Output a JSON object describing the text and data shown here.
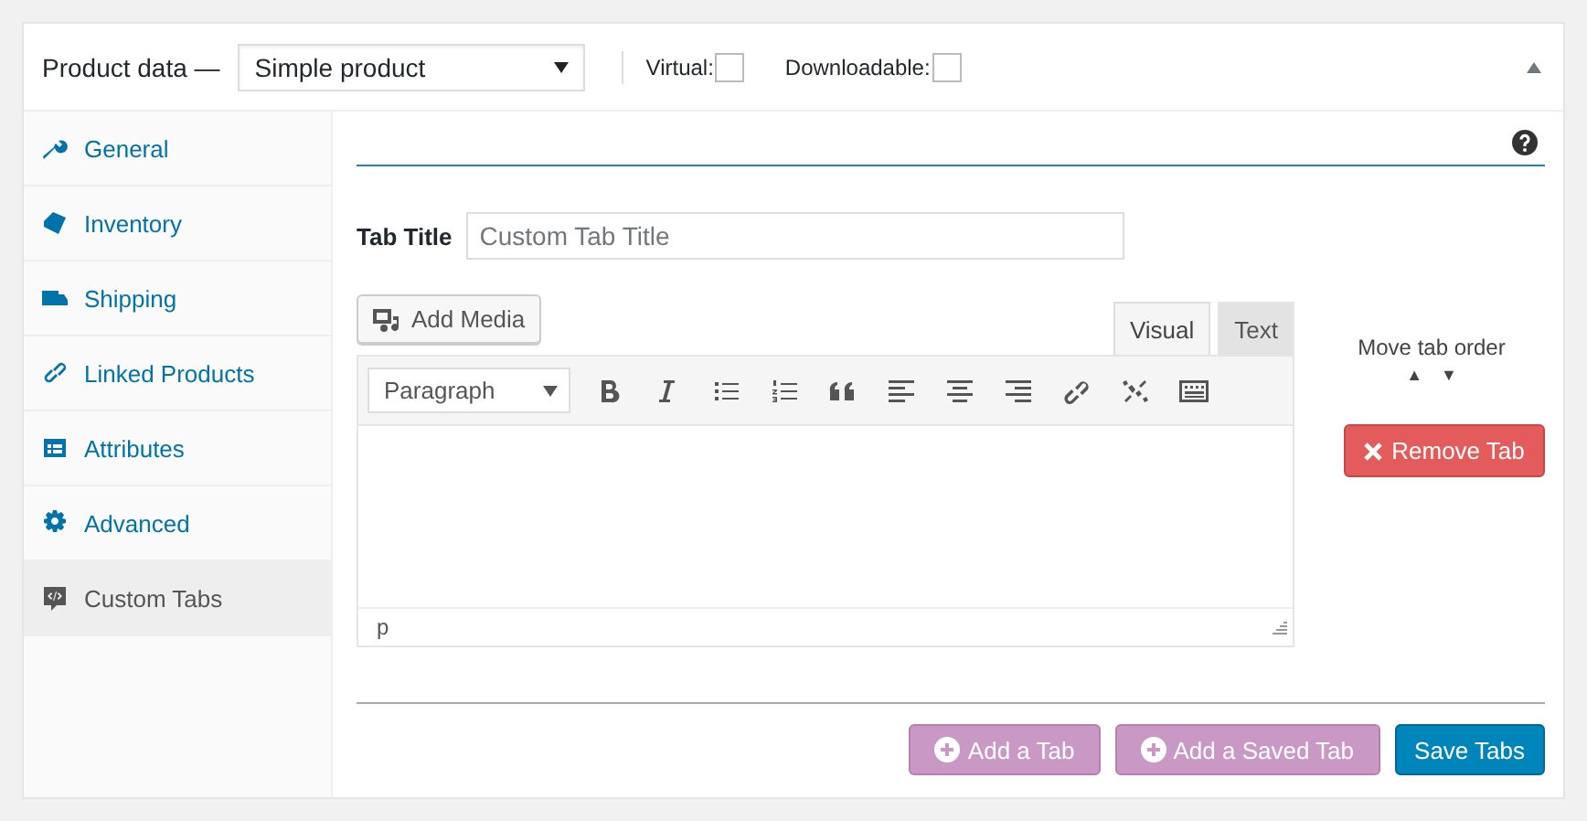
{
  "header": {
    "title": "Product data —",
    "product_type": "Simple product",
    "options": [
      {
        "label": "Virtual:",
        "checked": false
      },
      {
        "label": "Downloadable:",
        "checked": false
      }
    ]
  },
  "sidebar": {
    "items": [
      {
        "label": "General",
        "selected": false
      },
      {
        "label": "Inventory",
        "selected": false
      },
      {
        "label": "Shipping",
        "selected": false
      },
      {
        "label": "Linked Products",
        "selected": false
      },
      {
        "label": "Attributes",
        "selected": false
      },
      {
        "label": "Advanced",
        "selected": false
      },
      {
        "label": "Custom Tabs",
        "selected": true
      }
    ]
  },
  "tab_title": {
    "label": "Tab Title",
    "placeholder": "Custom Tab Title"
  },
  "editor": {
    "add_media": "Add Media",
    "tabs": [
      {
        "label": "Visual",
        "selected": true
      },
      {
        "label": "Text",
        "selected": false
      }
    ],
    "format": "Paragraph",
    "path": "p"
  },
  "order": {
    "label": "Move tab order",
    "up": "▲",
    "down": "▼"
  },
  "remove_button": "Remove Tab",
  "footer_buttons": [
    {
      "label": "Add a Tab",
      "kind": "add"
    },
    {
      "label": "Add a Saved Tab",
      "kind": "add"
    },
    {
      "label": "Save Tabs",
      "kind": "primary"
    }
  ]
}
